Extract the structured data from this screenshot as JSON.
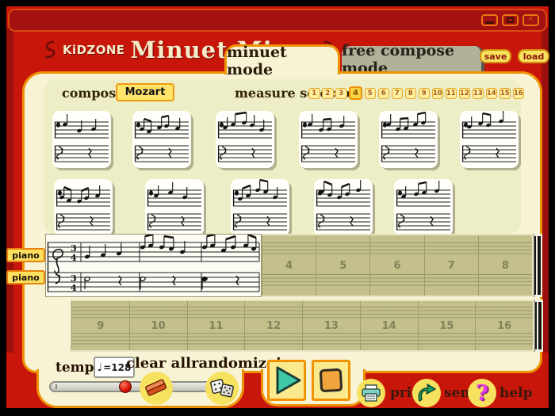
{
  "titlebar": {
    "brand": "KiDZONE",
    "app_title": "Minuet Mixer",
    "window_controls": [
      "minimize",
      "maximize",
      "close"
    ]
  },
  "tabs": {
    "minuet": "minuet mode",
    "free_compose": "free compose mode"
  },
  "file_actions": {
    "save": "save",
    "load": "load"
  },
  "composer": {
    "label": "composer",
    "value": "Mozart"
  },
  "measure_selector": {
    "label": "measure selector",
    "numbers": [
      "1",
      "2",
      "3",
      "4",
      "5",
      "6",
      "7",
      "8",
      "9",
      "10",
      "11",
      "12",
      "13",
      "14",
      "15",
      "16"
    ],
    "selected": "4"
  },
  "phrase_cards": {
    "top_row": [
      {
        "notes": [
          [
            16,
            13
          ],
          [
            34,
            21
          ],
          [
            52,
            19
          ]
        ],
        "beams": []
      },
      {
        "notes": [
          [
            12,
            19
          ],
          [
            21,
            22
          ],
          [
            34,
            17
          ],
          [
            43,
            15
          ],
          [
            57,
            18
          ]
        ],
        "beams": [
          [
            0,
            1
          ],
          [
            2,
            3
          ]
        ]
      },
      {
        "notes": [
          [
            12,
            17
          ],
          [
            22,
            13
          ],
          [
            36,
            11
          ],
          [
            46,
            14
          ],
          [
            58,
            20
          ]
        ],
        "beams": [
          [
            1,
            2
          ]
        ]
      },
      {
        "notes": [
          [
            14,
            13
          ],
          [
            28,
            20
          ],
          [
            38,
            19
          ],
          [
            54,
            15
          ]
        ],
        "beams": [
          [
            1,
            2
          ]
        ]
      },
      {
        "notes": [
          [
            12,
            13
          ],
          [
            24,
            19
          ],
          [
            34,
            18
          ],
          [
            46,
            13
          ],
          [
            56,
            11
          ]
        ],
        "beams": [
          [
            1,
            2
          ],
          [
            3,
            4
          ]
        ]
      },
      {
        "notes": [
          [
            12,
            16
          ],
          [
            26,
            12
          ],
          [
            36,
            14
          ],
          [
            52,
            9
          ]
        ],
        "beams": [
          [
            1,
            2
          ]
        ]
      }
    ],
    "bottom_row": [
      {
        "notes": [
          [
            10,
            19
          ],
          [
            19,
            23
          ],
          [
            32,
            24
          ],
          [
            41,
            20
          ],
          [
            55,
            17
          ]
        ],
        "beams": [
          [
            0,
            1
          ],
          [
            2,
            3
          ]
        ]
      },
      {
        "notes": [
          [
            14,
            17
          ],
          [
            32,
            13
          ],
          [
            50,
            19
          ]
        ],
        "beams": []
      },
      {
        "notes": [
          [
            12,
            21
          ],
          [
            22,
            17
          ],
          [
            34,
            10
          ],
          [
            44,
            12
          ],
          [
            56,
            19
          ]
        ],
        "beams": [
          [
            0,
            1
          ],
          [
            2,
            3
          ]
        ]
      },
      {
        "notes": [
          [
            10,
            12
          ],
          [
            20,
            16
          ],
          [
            32,
            19
          ],
          [
            42,
            15
          ],
          [
            56,
            10
          ]
        ],
        "beams": [
          [
            0,
            1
          ],
          [
            2,
            3
          ]
        ]
      },
      {
        "notes": [
          [
            12,
            18
          ],
          [
            28,
            15
          ],
          [
            38,
            13
          ],
          [
            54,
            11
          ]
        ],
        "beams": [
          [
            1,
            2
          ]
        ]
      }
    ]
  },
  "timeline": {
    "track_labels": [
      "piano",
      "piano"
    ],
    "time_signature": "3/4",
    "filled_measures": [
      1,
      2,
      3
    ],
    "row1_empty_cells": [
      "4",
      "5",
      "6",
      "7",
      "8"
    ],
    "row2_cells": [
      "9",
      "10",
      "11",
      "12",
      "13",
      "14",
      "15",
      "16"
    ],
    "melody_notes": [
      [
        52,
        26
      ],
      [
        72,
        24
      ],
      [
        92,
        22
      ],
      [
        122,
        14
      ],
      [
        132,
        12
      ],
      [
        146,
        14
      ],
      [
        158,
        16
      ],
      [
        172,
        20
      ],
      [
        200,
        14
      ],
      [
        210,
        12
      ],
      [
        224,
        18
      ],
      [
        236,
        14
      ],
      [
        252,
        12
      ],
      [
        262,
        16
      ]
    ],
    "melody_beams": [
      [
        3,
        4
      ],
      [
        5,
        6
      ],
      [
        8,
        9
      ],
      [
        10,
        11
      ],
      [
        12,
        13
      ]
    ],
    "bass_notes": [
      [
        52,
        56,
        "h"
      ],
      [
        92,
        58,
        "r"
      ],
      [
        122,
        56,
        "h"
      ],
      [
        160,
        58,
        "r"
      ],
      [
        200,
        56,
        "q"
      ],
      [
        240,
        58,
        "r"
      ]
    ]
  },
  "transport": {
    "tempo_label": "tempo",
    "tempo_note_glyph": "♩",
    "tempo_value": "=128",
    "clear_all_label": "clear all",
    "randomize_label": "randomize!"
  },
  "footer_links": {
    "print": "print",
    "send": "send",
    "help": "help"
  },
  "colors": {
    "background_red": "#c9160a",
    "dark_red": "#9c100c",
    "accent_orange": "#ef9202",
    "panel_cream": "#f8f3d4",
    "inner_khaki": "#edeec6",
    "timeline_khaki": "#c4c08b",
    "button_yellow": "#f6e25f",
    "play_teal": "#3fc9a6",
    "stop_orange": "#f2a43c",
    "help_magenta": "#e43ae4",
    "send_green": "#1f9e63"
  }
}
